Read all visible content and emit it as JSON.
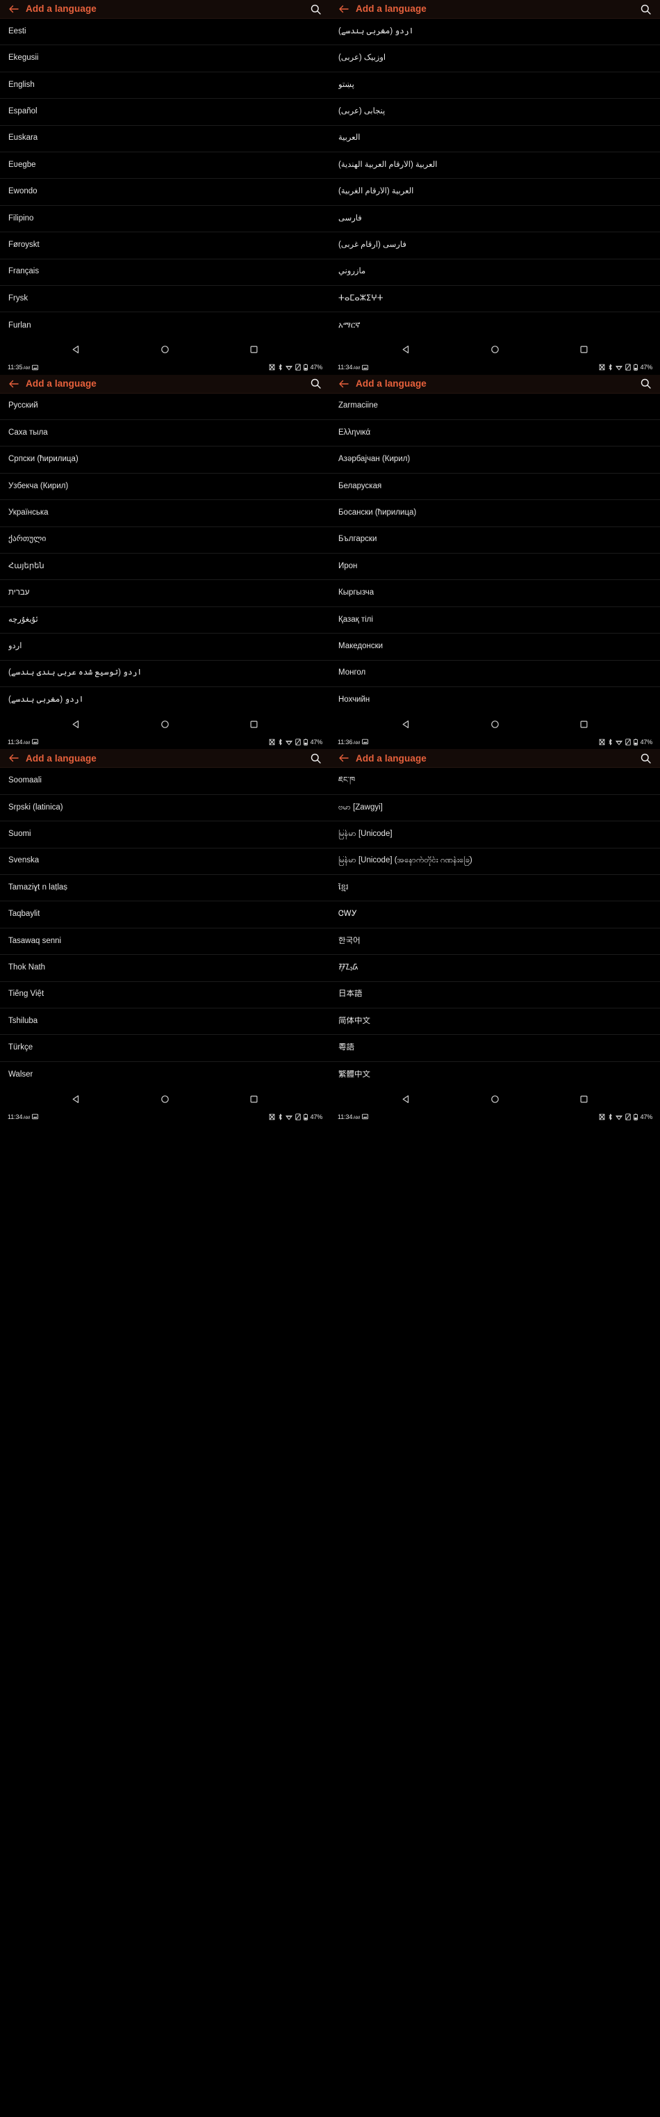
{
  "app": {
    "title": "Add a language",
    "accent_color": "#e8613c",
    "background_color": "#000000",
    "text_color": "#e6e6e6",
    "divider_color": "#1b1b1b",
    "appbar_background": "#140b08"
  },
  "icons": {
    "back": "back-arrow-icon",
    "search": "search-icon",
    "nav_back": "nav-back-triangle-icon",
    "nav_home": "nav-home-circle-icon",
    "nav_recents": "nav-recents-square-icon",
    "screenshot": "screenshot-icon",
    "nfc": "nfc-off-icon",
    "bluetooth": "bluetooth-icon",
    "wifi": "wifi-icon",
    "sim": "no-sim-icon",
    "battery": "battery-icon"
  },
  "status": {
    "battery_level": "47%",
    "ampm": "AM"
  },
  "panels": [
    {
      "id": "panel-1",
      "time": "11:35",
      "ampm": "AM",
      "battery": "47%",
      "rtl": false,
      "languages": [
        "Eesti",
        "Ekegusii",
        "English",
        "Español",
        "Euskara",
        "Eʋegbe",
        "Ewondo",
        "Filipino",
        "Føroyskt",
        "Français",
        "Frysk",
        "Furlan"
      ]
    },
    {
      "id": "panel-2",
      "time": "11:34",
      "ampm": "AM",
      "battery": "47%",
      "rtl": true,
      "languages": [
        "اردو (مغربی ہندسے)",
        "اوزبیک (عربی)",
        "پښتو",
        "پنجابی (عربی)",
        "العربية",
        "العربية (الأرقام العربية الهندية)",
        "العربية (الأرقام الغربية)",
        "فارسی",
        "فارسی (ارقام غربی)",
        "مأزروني",
        "ⵜⴰⵎⴰⵣⵉⵖⵜ",
        "አማርኛ"
      ]
    },
    {
      "id": "panel-3",
      "time": "11:34",
      "ampm": "AM",
      "battery": "47%",
      "rtl": false,
      "languages": [
        "Русский",
        "Саха тыла",
        "Српски (ћирилица)",
        "Ўзбекча (Кирил)",
        "Українська",
        "ქართული",
        "Հայերեն",
        "עברית",
        "ئۇيغۇرچە",
        "اردو",
        "اردو (توسیع شدہ عربی ہندی ہندسے)",
        "اردو (مغربی ہندسے)"
      ]
    },
    {
      "id": "panel-4",
      "time": "11:36",
      "ampm": "AM",
      "battery": "47%",
      "rtl": false,
      "languages": [
        "Zarmaciine",
        "Ελληνικά",
        "Азәрбајчан (Кирил)",
        "Беларуская",
        "Босански (ћирилица)",
        "Български",
        "Ирон",
        "Кыргызча",
        "Қазақ тілі",
        "Македонски",
        "Монгол",
        "Нохчийн"
      ]
    },
    {
      "id": "panel-5",
      "time": "11:34",
      "ampm": "AM",
      "battery": "47%",
      "rtl": false,
      "languages": [
        "Soomaali",
        "Srpski (latinica)",
        "Suomi",
        "Svenska",
        "Tamaziɣt n laṭlaṣ",
        "Taqbaylit",
        "Tasawaq senni",
        "Thok Nath",
        "Tiếng Việt",
        "Tshiluba",
        "Türkçe",
        "Walser"
      ]
    },
    {
      "id": "panel-6",
      "time": "11:34",
      "ampm": "AM",
      "battery": "47%",
      "rtl": false,
      "languages": [
        "ཇོང་ཁ",
        "ဗမာ [Zawgyi]",
        "မြန်မာ [Unicode]",
        "မြန်မာ [Unicode] (အနောက်တိုင်း ဂဏန်းခြေ)",
        "ខ្មែរ",
        "ᏣᎳᎩ",
        "한국어",
        "ᮞᮥᮔ᮪ᮓ",
        "日本語",
        "简体中文",
        "粵語",
        "繁體中文"
      ]
    }
  ]
}
